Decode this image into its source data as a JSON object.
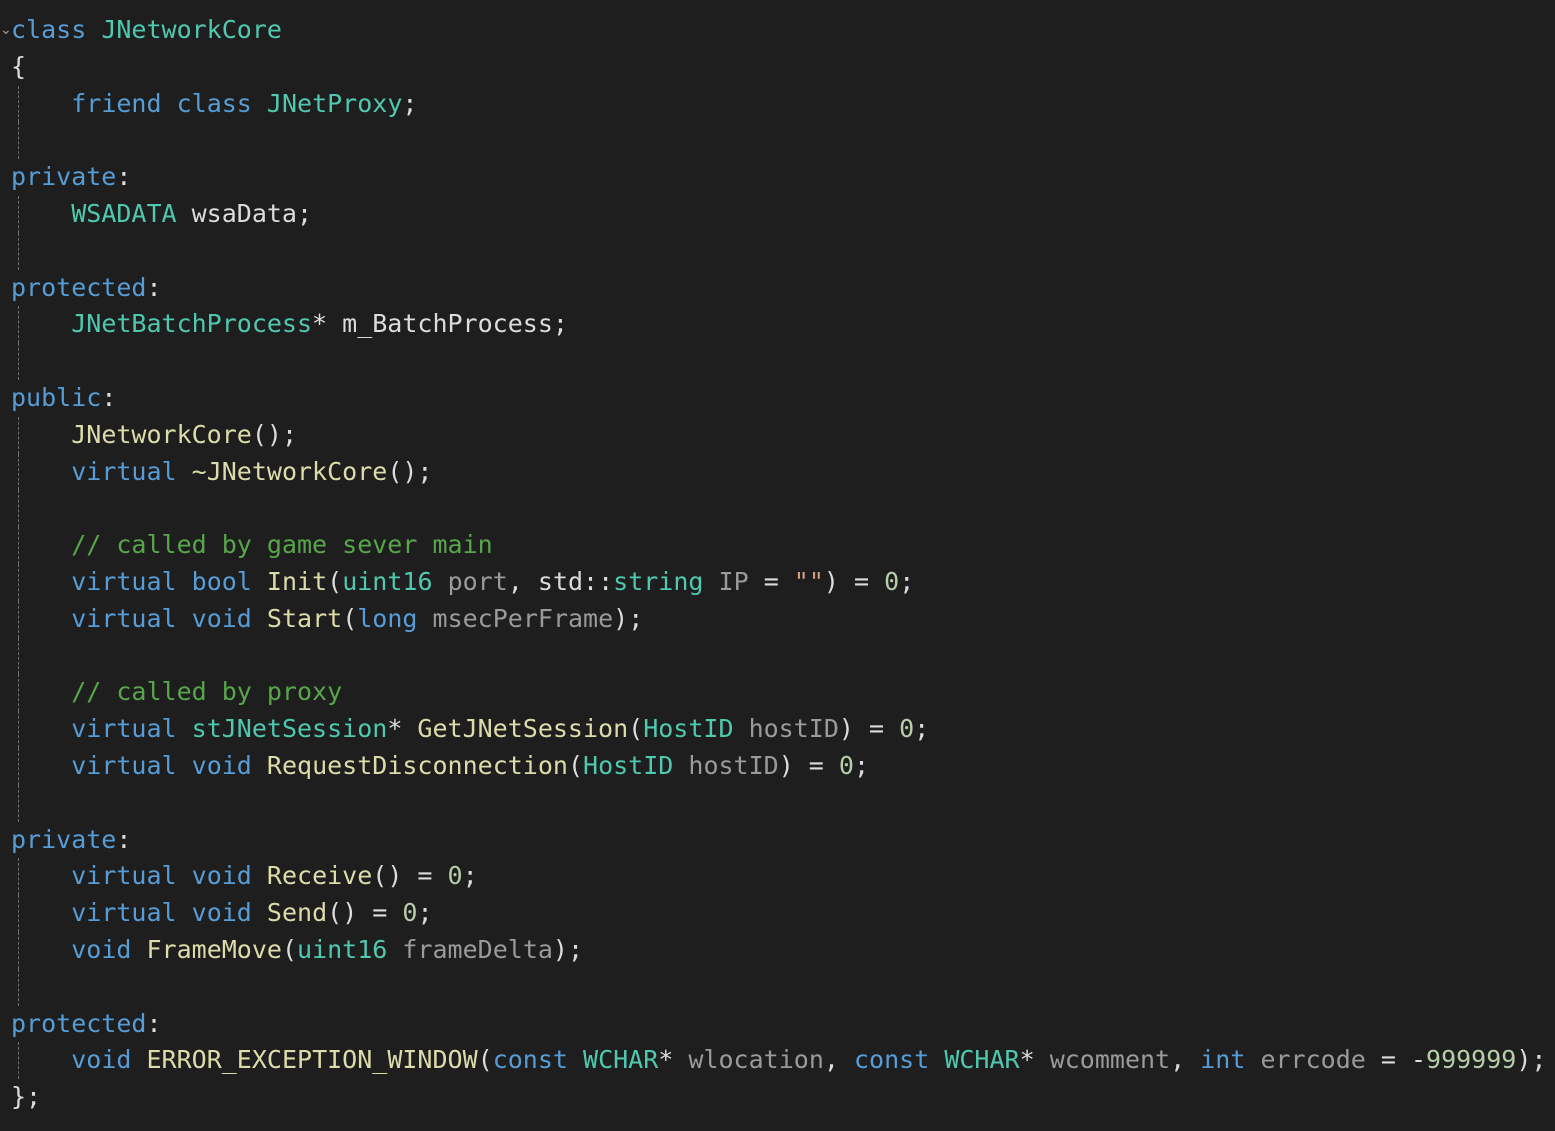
{
  "editor": {
    "colors": {
      "background": "#1e1e1e",
      "keyword": "#569cd6",
      "type": "#4ec9b0",
      "function": "#dcdcaa",
      "parameter": "#9a9a9a",
      "comment": "#57a64a",
      "number": "#b5cea8",
      "string": "#d69d85",
      "plain": "#dcdcdc"
    },
    "fold_icon": "collapse-chevron-icon",
    "lines": [
      {
        "guide": false,
        "fold": true,
        "tokens": [
          {
            "t": "class",
            "c": "kw"
          },
          {
            "t": " ",
            "c": "plain"
          },
          {
            "t": "JNetworkCore",
            "c": "type"
          }
        ]
      },
      {
        "guide": false,
        "tokens": [
          {
            "t": "{",
            "c": "plain"
          }
        ]
      },
      {
        "guide": true,
        "tokens": [
          {
            "t": "    ",
            "c": "plain"
          },
          {
            "t": "friend",
            "c": "kw"
          },
          {
            "t": " ",
            "c": "plain"
          },
          {
            "t": "class",
            "c": "kw"
          },
          {
            "t": " ",
            "c": "plain"
          },
          {
            "t": "JNetProxy",
            "c": "type"
          },
          {
            "t": ";",
            "c": "plain"
          }
        ]
      },
      {
        "guide": true,
        "tokens": []
      },
      {
        "guide": false,
        "tokens": [
          {
            "t": "private",
            "c": "kw"
          },
          {
            "t": ":",
            "c": "plain"
          }
        ]
      },
      {
        "guide": true,
        "tokens": [
          {
            "t": "    ",
            "c": "plain"
          },
          {
            "t": "WSADATA",
            "c": "type"
          },
          {
            "t": " wsaData;",
            "c": "plain"
          }
        ]
      },
      {
        "guide": true,
        "tokens": []
      },
      {
        "guide": false,
        "tokens": [
          {
            "t": "protected",
            "c": "kw"
          },
          {
            "t": ":",
            "c": "plain"
          }
        ]
      },
      {
        "guide": true,
        "tokens": [
          {
            "t": "    ",
            "c": "plain"
          },
          {
            "t": "JNetBatchProcess",
            "c": "type"
          },
          {
            "t": "* m_BatchProcess;",
            "c": "plain"
          }
        ]
      },
      {
        "guide": true,
        "tokens": []
      },
      {
        "guide": false,
        "tokens": [
          {
            "t": "public",
            "c": "kw"
          },
          {
            "t": ":",
            "c": "plain"
          }
        ]
      },
      {
        "guide": true,
        "tokens": [
          {
            "t": "    ",
            "c": "plain"
          },
          {
            "t": "JNetworkCore",
            "c": "fn"
          },
          {
            "t": "();",
            "c": "plain"
          }
        ]
      },
      {
        "guide": true,
        "tokens": [
          {
            "t": "    ",
            "c": "plain"
          },
          {
            "t": "virtual",
            "c": "kw"
          },
          {
            "t": " ",
            "c": "plain"
          },
          {
            "t": "~JNetworkCore",
            "c": "fn"
          },
          {
            "t": "();",
            "c": "plain"
          }
        ]
      },
      {
        "guide": true,
        "tokens": []
      },
      {
        "guide": true,
        "tokens": [
          {
            "t": "    ",
            "c": "plain"
          },
          {
            "t": "// called by game sever main",
            "c": "comment"
          }
        ]
      },
      {
        "guide": true,
        "tokens": [
          {
            "t": "    ",
            "c": "plain"
          },
          {
            "t": "virtual",
            "c": "kw"
          },
          {
            "t": " ",
            "c": "plain"
          },
          {
            "t": "bool",
            "c": "kw"
          },
          {
            "t": " ",
            "c": "plain"
          },
          {
            "t": "Init",
            "c": "fn"
          },
          {
            "t": "(",
            "c": "plain"
          },
          {
            "t": "uint16",
            "c": "type"
          },
          {
            "t": " ",
            "c": "plain"
          },
          {
            "t": "port",
            "c": "param"
          },
          {
            "t": ", std::",
            "c": "plain"
          },
          {
            "t": "string",
            "c": "type"
          },
          {
            "t": " ",
            "c": "plain"
          },
          {
            "t": "IP",
            "c": "param"
          },
          {
            "t": " = ",
            "c": "plain"
          },
          {
            "t": "\"\"",
            "c": "str"
          },
          {
            "t": ") = ",
            "c": "plain"
          },
          {
            "t": "0",
            "c": "num"
          },
          {
            "t": ";",
            "c": "plain"
          }
        ]
      },
      {
        "guide": true,
        "tokens": [
          {
            "t": "    ",
            "c": "plain"
          },
          {
            "t": "virtual",
            "c": "kw"
          },
          {
            "t": " ",
            "c": "plain"
          },
          {
            "t": "void",
            "c": "kw"
          },
          {
            "t": " ",
            "c": "plain"
          },
          {
            "t": "Start",
            "c": "fn"
          },
          {
            "t": "(",
            "c": "plain"
          },
          {
            "t": "long",
            "c": "kw"
          },
          {
            "t": " ",
            "c": "plain"
          },
          {
            "t": "msecPerFrame",
            "c": "param"
          },
          {
            "t": ");",
            "c": "plain"
          }
        ]
      },
      {
        "guide": true,
        "tokens": []
      },
      {
        "guide": true,
        "tokens": [
          {
            "t": "    ",
            "c": "plain"
          },
          {
            "t": "// called by proxy",
            "c": "comment"
          }
        ]
      },
      {
        "guide": true,
        "tokens": [
          {
            "t": "    ",
            "c": "plain"
          },
          {
            "t": "virtual",
            "c": "kw"
          },
          {
            "t": " ",
            "c": "plain"
          },
          {
            "t": "stJNetSession",
            "c": "type"
          },
          {
            "t": "* ",
            "c": "plain"
          },
          {
            "t": "GetJNetSession",
            "c": "fn"
          },
          {
            "t": "(",
            "c": "plain"
          },
          {
            "t": "HostID",
            "c": "type"
          },
          {
            "t": " ",
            "c": "plain"
          },
          {
            "t": "hostID",
            "c": "param"
          },
          {
            "t": ") = ",
            "c": "plain"
          },
          {
            "t": "0",
            "c": "num"
          },
          {
            "t": ";",
            "c": "plain"
          }
        ]
      },
      {
        "guide": true,
        "tokens": [
          {
            "t": "    ",
            "c": "plain"
          },
          {
            "t": "virtual",
            "c": "kw"
          },
          {
            "t": " ",
            "c": "plain"
          },
          {
            "t": "void",
            "c": "kw"
          },
          {
            "t": " ",
            "c": "plain"
          },
          {
            "t": "RequestDisconnection",
            "c": "fn"
          },
          {
            "t": "(",
            "c": "plain"
          },
          {
            "t": "HostID",
            "c": "type"
          },
          {
            "t": " ",
            "c": "plain"
          },
          {
            "t": "hostID",
            "c": "param"
          },
          {
            "t": ") = ",
            "c": "plain"
          },
          {
            "t": "0",
            "c": "num"
          },
          {
            "t": ";",
            "c": "plain"
          }
        ]
      },
      {
        "guide": true,
        "tokens": []
      },
      {
        "guide": false,
        "tokens": [
          {
            "t": "private",
            "c": "kw"
          },
          {
            "t": ":",
            "c": "plain"
          }
        ]
      },
      {
        "guide": true,
        "tokens": [
          {
            "t": "    ",
            "c": "plain"
          },
          {
            "t": "virtual",
            "c": "kw"
          },
          {
            "t": " ",
            "c": "plain"
          },
          {
            "t": "void",
            "c": "kw"
          },
          {
            "t": " ",
            "c": "plain"
          },
          {
            "t": "Receive",
            "c": "fn"
          },
          {
            "t": "() = ",
            "c": "plain"
          },
          {
            "t": "0",
            "c": "num"
          },
          {
            "t": ";",
            "c": "plain"
          }
        ]
      },
      {
        "guide": true,
        "tokens": [
          {
            "t": "    ",
            "c": "plain"
          },
          {
            "t": "virtual",
            "c": "kw"
          },
          {
            "t": " ",
            "c": "plain"
          },
          {
            "t": "void",
            "c": "kw"
          },
          {
            "t": " ",
            "c": "plain"
          },
          {
            "t": "Send",
            "c": "fn"
          },
          {
            "t": "() = ",
            "c": "plain"
          },
          {
            "t": "0",
            "c": "num"
          },
          {
            "t": ";",
            "c": "plain"
          }
        ]
      },
      {
        "guide": true,
        "tokens": [
          {
            "t": "    ",
            "c": "plain"
          },
          {
            "t": "void",
            "c": "kw"
          },
          {
            "t": " ",
            "c": "plain"
          },
          {
            "t": "FrameMove",
            "c": "fn"
          },
          {
            "t": "(",
            "c": "plain"
          },
          {
            "t": "uint16",
            "c": "type"
          },
          {
            "t": " ",
            "c": "plain"
          },
          {
            "t": "frameDelta",
            "c": "param"
          },
          {
            "t": ");",
            "c": "plain"
          }
        ]
      },
      {
        "guide": true,
        "tokens": []
      },
      {
        "guide": false,
        "tokens": [
          {
            "t": "protected",
            "c": "kw"
          },
          {
            "t": ":",
            "c": "plain"
          }
        ]
      },
      {
        "guide": true,
        "tokens": [
          {
            "t": "    ",
            "c": "plain"
          },
          {
            "t": "void",
            "c": "kw"
          },
          {
            "t": " ",
            "c": "plain"
          },
          {
            "t": "ERROR_EXCEPTION_WINDOW",
            "c": "fn"
          },
          {
            "t": "(",
            "c": "plain"
          },
          {
            "t": "const",
            "c": "kw"
          },
          {
            "t": " ",
            "c": "plain"
          },
          {
            "t": "WCHAR",
            "c": "type"
          },
          {
            "t": "* ",
            "c": "plain"
          },
          {
            "t": "wlocation",
            "c": "param"
          },
          {
            "t": ", ",
            "c": "plain"
          },
          {
            "t": "const",
            "c": "kw"
          },
          {
            "t": " ",
            "c": "plain"
          },
          {
            "t": "WCHAR",
            "c": "type"
          },
          {
            "t": "* ",
            "c": "plain"
          },
          {
            "t": "wcomment",
            "c": "param"
          },
          {
            "t": ", ",
            "c": "plain"
          },
          {
            "t": "int",
            "c": "kw"
          },
          {
            "t": " ",
            "c": "plain"
          },
          {
            "t": "errcode",
            "c": "param"
          },
          {
            "t": " = -",
            "c": "plain"
          },
          {
            "t": "999999",
            "c": "num"
          },
          {
            "t": ");",
            "c": "plain"
          }
        ]
      },
      {
        "guide": false,
        "tokens": [
          {
            "t": "};",
            "c": "plain"
          }
        ]
      }
    ]
  }
}
